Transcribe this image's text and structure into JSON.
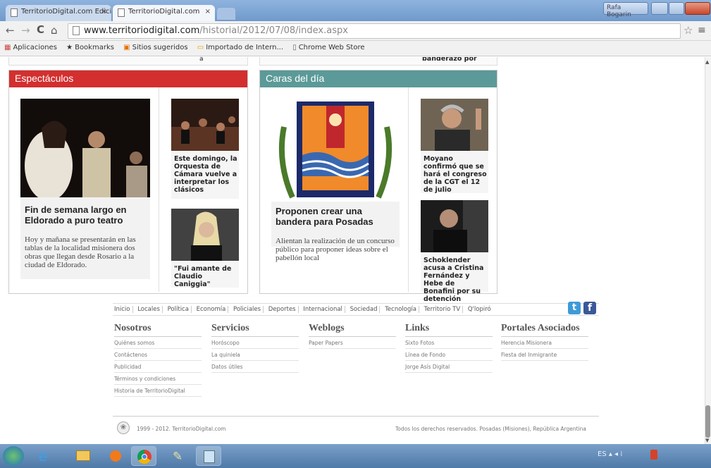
{
  "browser": {
    "tabs": [
      {
        "label": "TerritorioDigital.com Edici",
        "close": "×"
      },
      {
        "label": "TerritorioDigital.com",
        "close": "×"
      }
    ],
    "window_user": "Rafa Bogarin",
    "url_host": "www.territoriodigital.com",
    "url_path": "/historial/2012/07/08/index.aspx",
    "bookmarks": [
      {
        "label": "Aplicaciones",
        "icon": "apps-grid-icon"
      },
      {
        "label": "Bookmarks",
        "icon": "star-icon"
      },
      {
        "label": "Sitios sugeridos",
        "icon": "suggested-sites-icon"
      },
      {
        "label": "Importado de Intern...",
        "icon": "folder-icon"
      },
      {
        "label": "Chrome Web Store",
        "icon": "page-icon"
      }
    ]
  },
  "page": {
    "top_fragment_left": "á",
    "top_fragment_right": "banderazo por",
    "espectaculos": {
      "title": "Espectáculos",
      "color": "#d32f2f",
      "main_story": {
        "headline": "Fin de semana largo en Eldorado a puro teatro",
        "summary": "Hoy y mañana se presentarán en las tablas de la localidad misionera dos obras que llegan desde Rosario a la ciudad de Eldorado."
      },
      "side_stories": [
        {
          "caption": "Este domingo, la Orquesta de Cámara vuelve a interpretar los clásicos"
        },
        {
          "caption": "\"Fui amante de Claudio Caniggia\""
        }
      ]
    },
    "caras": {
      "title": "Caras del día",
      "color": "#5b9a98",
      "main_story": {
        "headline": "Proponen crear una bandera para Posadas",
        "summary": "Alientan la realización de un concurso público para proponer ideas sobre el pabellón local"
      },
      "side_stories": [
        {
          "caption": "Moyano confirmó que se hará el congreso de la CGT el 12 de julio"
        },
        {
          "caption": "Schoklender acusa a Cristina Fernández y Hebe de Bonafini por su detención"
        }
      ]
    },
    "footer": {
      "nav": [
        "Inicio",
        "Locales",
        "Política",
        "Economía",
        "Policiales",
        "Deportes",
        "Internacional",
        "Sociedad",
        "Tecnología",
        "Territorio TV",
        "Q'lopiró"
      ],
      "columns": [
        {
          "title": "Nosotros",
          "items": [
            "Quiénes somos",
            "Contáctenos",
            "Publicidad",
            "Términos y condiciones",
            "Historia de TerritorioDigital"
          ]
        },
        {
          "title": "Servicios",
          "items": [
            "Horóscopo",
            "La quiniela",
            "Datos útiles"
          ]
        },
        {
          "title": "Weblogs",
          "items": [
            "Paper Papers"
          ]
        },
        {
          "title": "Links",
          "items": [
            "Sixto Fotos",
            "Línea de Fondo",
            "Jorge Asís Digital"
          ]
        },
        {
          "title": "Portales Asociados",
          "items": [
            "Herencia Misionera",
            "Fiesta del Inmigrante"
          ]
        }
      ],
      "copyright": "1999 - 2012. TerritorioDigital.com",
      "rights": "Todos los derechos reservados. Posadas (Misiones), República Argentina",
      "social": [
        {
          "icon": "twitter-icon",
          "glyph": "t"
        },
        {
          "icon": "facebook-icon",
          "glyph": "f"
        }
      ]
    }
  },
  "taskbar": {
    "items": [
      "start-orb-icon",
      "ie-icon",
      "explorer-icon",
      "media-player-icon",
      "chrome-icon",
      "paint-icon",
      "notepad-icon"
    ],
    "tray": "ES ▴ ◂ ⁞"
  }
}
